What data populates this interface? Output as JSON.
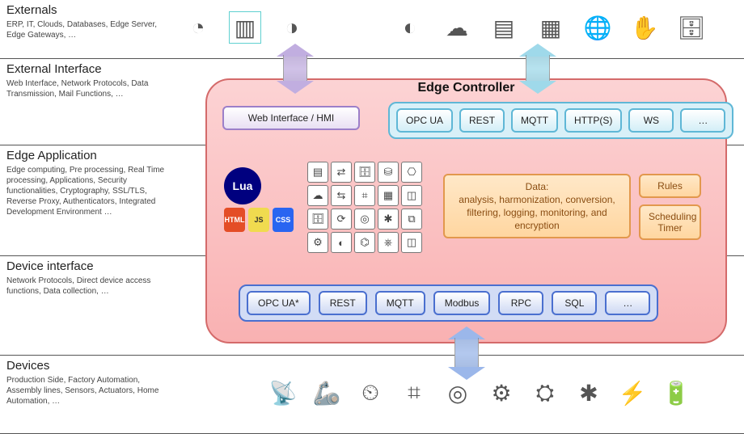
{
  "bands": {
    "externals": {
      "title": "Externals",
      "desc": "ERP, IT, Clouds, Databases, Edge Server, Edge Gateways, …"
    },
    "externalInterface": {
      "title": "External Interface",
      "desc": "Web Interface, Network Protocols, Data Transmission, Mail Functions, …"
    },
    "edgeApplication": {
      "title": "Edge Application",
      "desc": "Edge computing, Pre processing, Real Time processing, Applications, Security functionalities, Cryptography, SSL/TLS, Reverse Proxy, Authenticators, Integrated Development Environment …"
    },
    "deviceInterface": {
      "title": "Device interface",
      "desc": "Network Protocols, Direct device access functions, Data collection, …"
    },
    "devices": {
      "title": "Devices",
      "desc": "Production Side, Factory Automation, Assembly lines, Sensors, Actuators, Home Automation, …"
    }
  },
  "edgeController": {
    "title": "Edge Controller",
    "webInterface": "Web Interface /  HMI",
    "upperProtocols": [
      "OPC UA",
      "REST",
      "MQTT",
      "HTTP(S)",
      "WS",
      "…"
    ],
    "lowerProtocols": [
      "OPC UA*",
      "REST",
      "MQTT",
      "Modbus",
      "RPC",
      "SQL",
      "…"
    ],
    "dataBox": {
      "heading": "Data:",
      "body": "analysis, harmonization, conversion, filtering, logging, monitoring, and encryption"
    },
    "rules": "Rules",
    "scheduling": "Scheduling Timer",
    "logos": {
      "lua": "Lua",
      "html": "HTML",
      "js": "JS",
      "css": "CSS"
    }
  },
  "topIcons": [
    "pie-chart-icon",
    "dashboard-icon",
    "gauges-icon",
    "speedometer-icon",
    "cloud-network-icon",
    "server-rack-icon",
    "blade-server-icon",
    "globe-icon",
    "analytics-hand-icon",
    "database-sql-icon"
  ],
  "bottomIcons": [
    "antenna-icon",
    "robot-arm-icon",
    "meter-icon",
    "cpu-chip-icon",
    "radar-icon",
    "gears-icon",
    "chip-gear-icon",
    "wind-turbine-icon",
    "power-tower-icon",
    "battery-icon"
  ],
  "glyphs": {
    "pie-chart-icon": "◔",
    "dashboard-icon": "▥",
    "gauges-icon": "◑",
    "speedometer-icon": "◐",
    "cloud-network-icon": "☁",
    "server-rack-icon": "▤",
    "blade-server-icon": "▦",
    "globe-icon": "🌐",
    "analytics-hand-icon": "✋",
    "database-sql-icon": "🗄",
    "antenna-icon": "📡",
    "robot-arm-icon": "🦾",
    "meter-icon": "⏲",
    "cpu-chip-icon": "⌗",
    "radar-icon": "◎",
    "gears-icon": "⚙",
    "chip-gear-icon": "⛭",
    "wind-turbine-icon": "✱",
    "power-tower-icon": "⚡",
    "battery-icon": "🔋"
  }
}
